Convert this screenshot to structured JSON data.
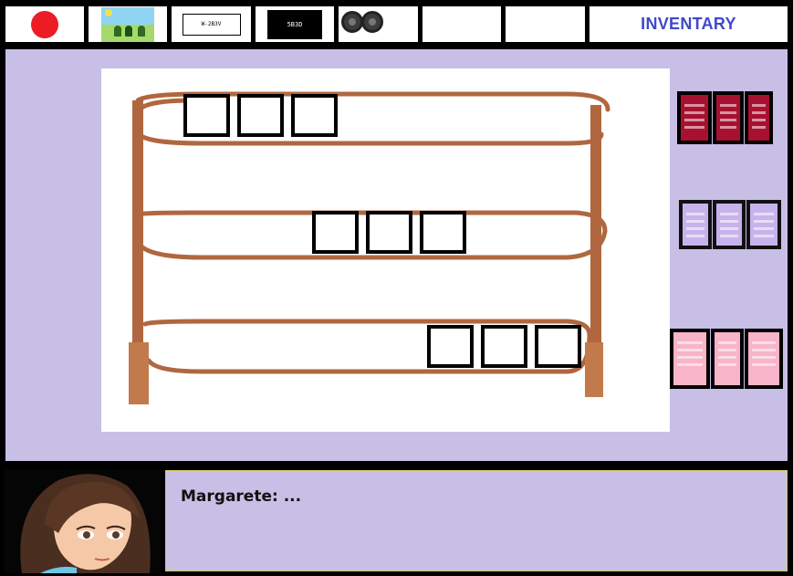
{
  "inventory": {
    "title": "INVENTARY",
    "slots": [
      {
        "icon": "red-dot-icon",
        "color": "#ed1c24"
      },
      {
        "icon": "landscape-picture-icon"
      },
      {
        "icon": "white-note-icon",
        "text": "W-2B3V"
      },
      {
        "icon": "black-note-icon",
        "text": "5B3D"
      },
      {
        "icon": "wheels-icon"
      },
      {
        "icon": "empty"
      },
      {
        "icon": "empty"
      }
    ]
  },
  "shelf": {
    "rows": 3,
    "slots_per_row": 3,
    "colors": {
      "wood": "#b0673f",
      "panel": "#ffffff",
      "background": "#c8bfe7"
    }
  },
  "books": {
    "groups": [
      {
        "color_name": "dark-red",
        "color": "#a8102f",
        "count": 3
      },
      {
        "color_name": "lilac",
        "color": "#c7b3ec",
        "count": 3
      },
      {
        "color_name": "pink",
        "color": "#f8b4c8",
        "count": 3
      }
    ]
  },
  "dialogue": {
    "speaker": "Margarete",
    "text": "...",
    "line": "Margarete: ..."
  },
  "colors": {
    "accent": "#3f48cc",
    "panel_purple": "#c8bfe7",
    "frame": "#000000"
  }
}
